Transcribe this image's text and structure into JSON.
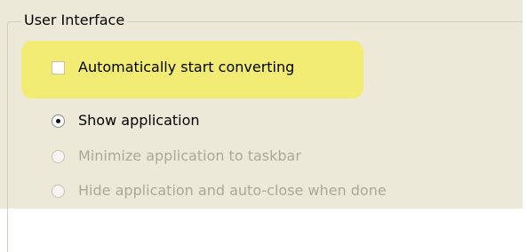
{
  "group": {
    "title": "User Interface"
  },
  "checkbox": {
    "label": "Automatically start converting",
    "checked": false,
    "highlight_color": "#f2ec74"
  },
  "radios": [
    {
      "label": "Show application",
      "selected": true,
      "enabled": true
    },
    {
      "label": "Minimize application to taskbar",
      "selected": false,
      "enabled": false
    },
    {
      "label": "Hide application and auto-close when done",
      "selected": false,
      "enabled": false
    }
  ],
  "colors": {
    "panel": "#ece9d8",
    "disabled_text": "#aca899"
  }
}
